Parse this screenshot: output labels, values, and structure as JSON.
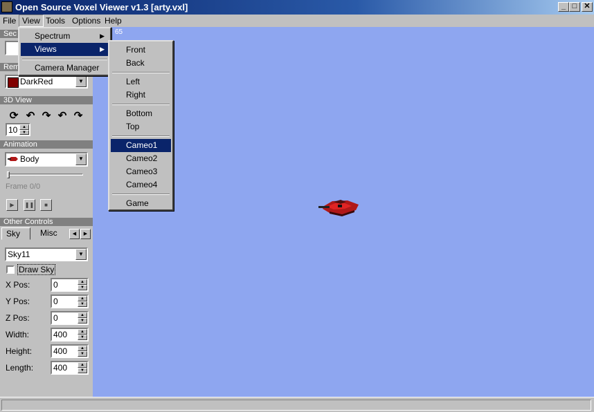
{
  "window": {
    "title": "Open Source Voxel Viewer v1.3 [arty.vxl]",
    "minimize": "_",
    "maximize": "□",
    "close": "✕"
  },
  "menubar": [
    "File",
    "View",
    "Tools",
    "Options",
    "Help"
  ],
  "view_menu": {
    "items": [
      "Spectrum",
      "Views",
      "Camera Manager"
    ],
    "submenu_arrow": "▶"
  },
  "views_submenu": {
    "groups": [
      [
        "Front",
        "Back"
      ],
      [
        "Left",
        "Right"
      ],
      [
        "Bottom",
        "Top"
      ],
      [
        "Cameo1",
        "Cameo2",
        "Cameo3",
        "Cameo4"
      ],
      [
        "Game"
      ]
    ],
    "highlighted": "Cameo1"
  },
  "left_panel": {
    "section_partial": "Sec",
    "remap_partial": "Rem",
    "remap_color_name": "DarkRed",
    "remap_color_hex": "#800000",
    "view3d_header": "3D View",
    "rotation_icons": [
      "rotate-icon",
      "rotate-left-icon",
      "rotate-right-icon",
      "undo-arrow-icon",
      "redo-arrow-icon"
    ],
    "rotation_glyphs": [
      "⟳",
      "↶",
      "↷",
      "↶",
      "↷"
    ],
    "step_value": "10",
    "animation_header": "Animation",
    "animation_section": "Body",
    "frame_label": "Frame 0/0",
    "play_glyphs": [
      "▶",
      "❚❚",
      "■"
    ],
    "other_controls_header": "Other Controls",
    "tabs": [
      "Sky",
      "Misc"
    ],
    "tab_nav": [
      "◀",
      "▶"
    ],
    "sky_select": "Sky11",
    "draw_sky_label": "Draw Sky",
    "draw_sky_checked": false,
    "fields": [
      {
        "label": "X Pos:",
        "value": "0"
      },
      {
        "label": "Y Pos:",
        "value": "0"
      },
      {
        "label": "Z Pos:",
        "value": "0"
      },
      {
        "label": "Width:",
        "value": "400"
      },
      {
        "label": "Height:",
        "value": "400"
      },
      {
        "label": "Length:",
        "value": "400"
      }
    ]
  },
  "viewport": {
    "corner_text": "65",
    "background": "#8ea6f0"
  },
  "dropdown_arrow": "▼",
  "spin_up": "▲",
  "spin_down": "▼"
}
